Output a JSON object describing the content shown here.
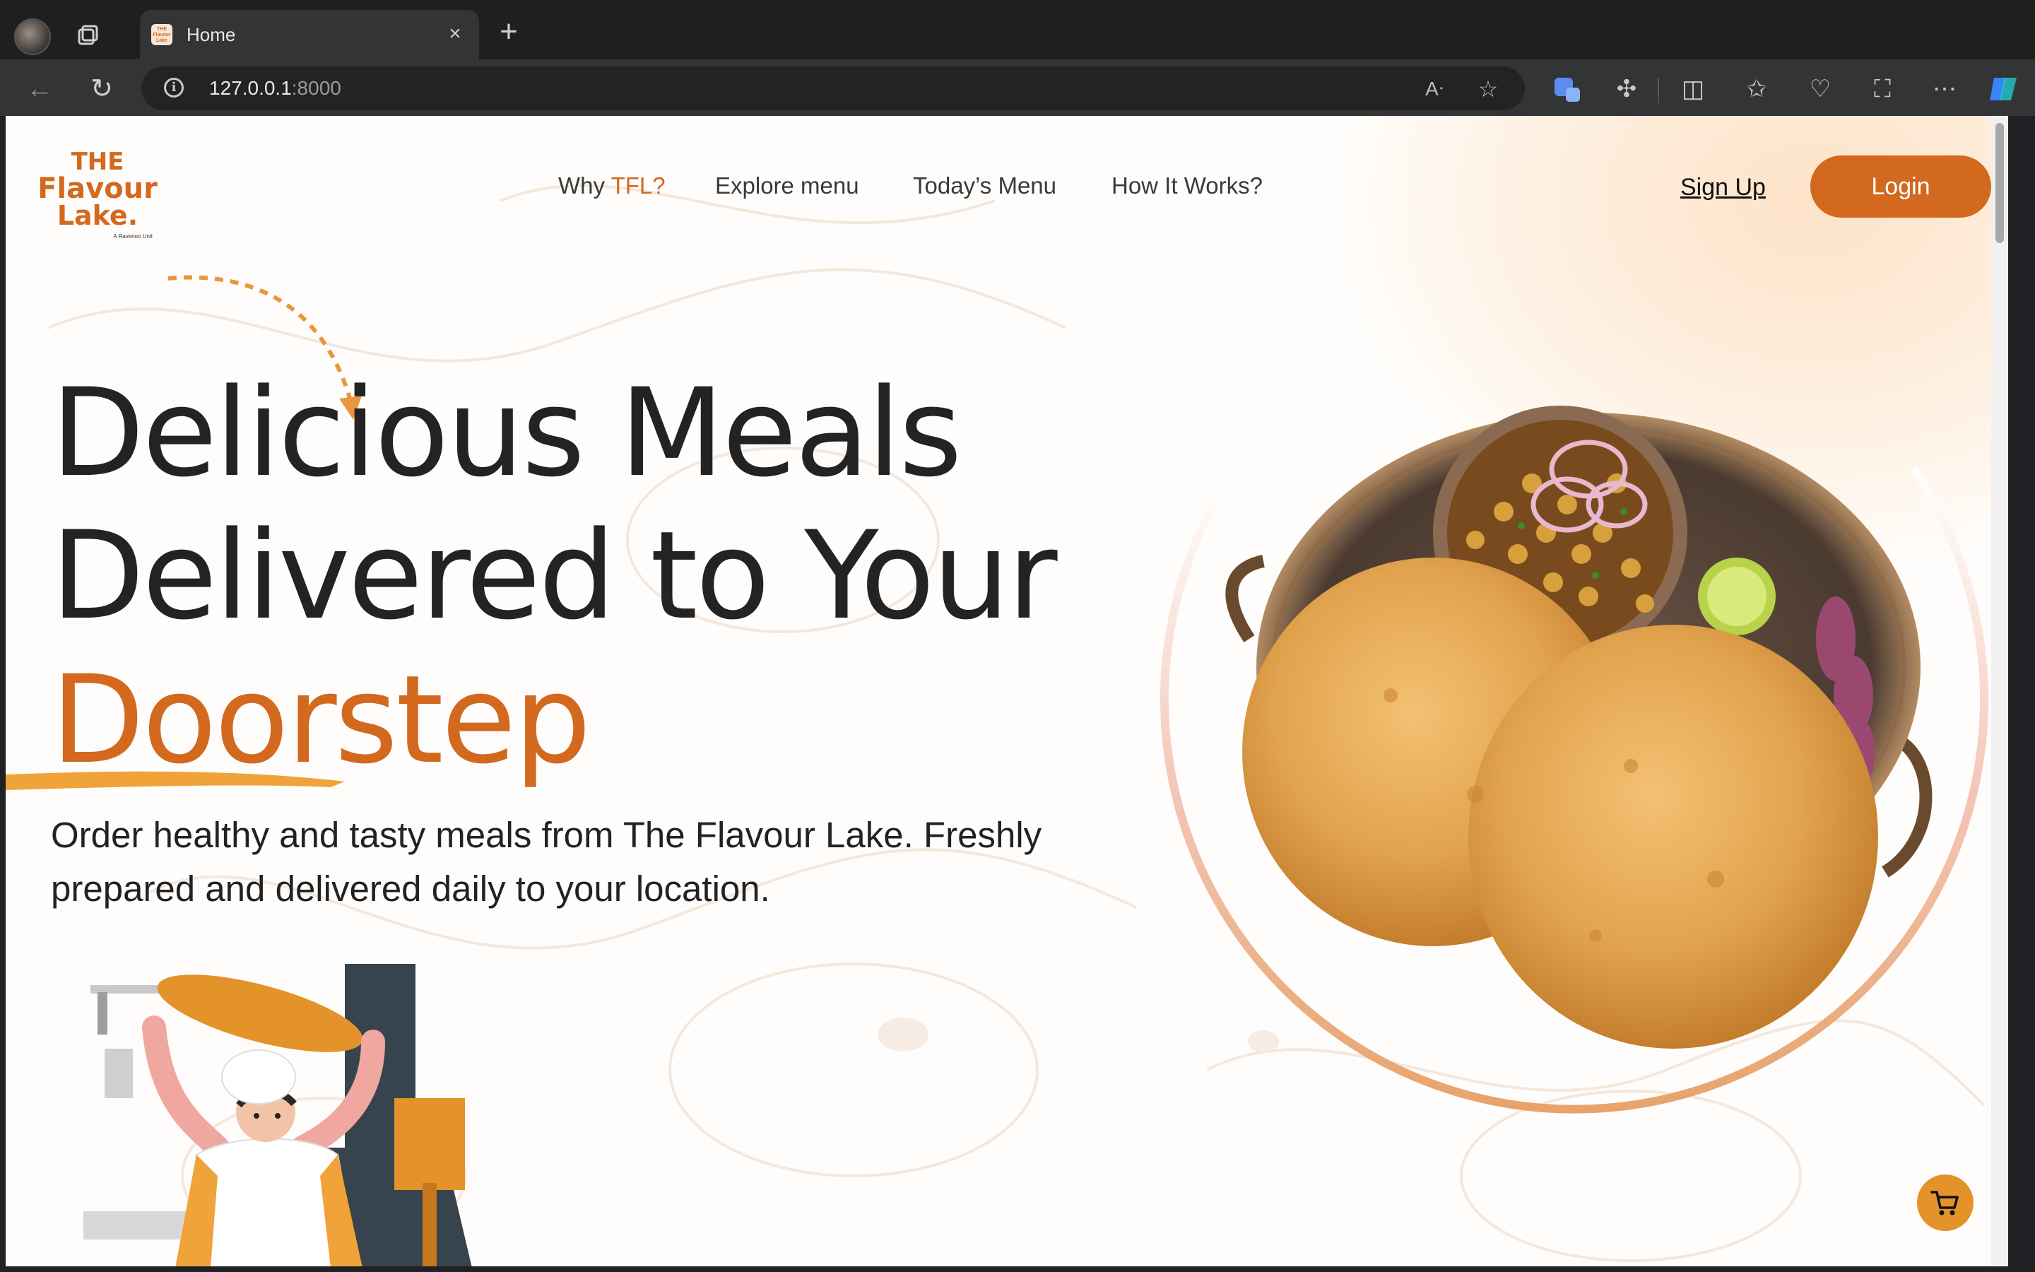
{
  "browser": {
    "tab_title": "Home",
    "tab_favicon_text": "THE Flavour Lake",
    "url_host": "127.0.0.1",
    "url_port": ":8000"
  },
  "site": {
    "logo": {
      "line1": "THE",
      "line2": "Flavour",
      "line3": "Lake.",
      "tagline": "A Ravenoo Unit"
    },
    "nav": {
      "why_prefix": "Why ",
      "why_accent": "TFL?",
      "explore": "Explore menu",
      "today": "Today’s Menu",
      "how": "How It Works?"
    },
    "signup": "Sign Up",
    "login": "Login",
    "hero": {
      "line1": "Delicious Meals",
      "line2": "Delivered to Your",
      "line3": "Doorstep",
      "subtext": "Order healthy and tasty meals from The Flavour Lake. Freshly prepared and delivered daily to your location."
    },
    "colors": {
      "accent": "#d2691e",
      "cart": "#e4922a"
    }
  }
}
